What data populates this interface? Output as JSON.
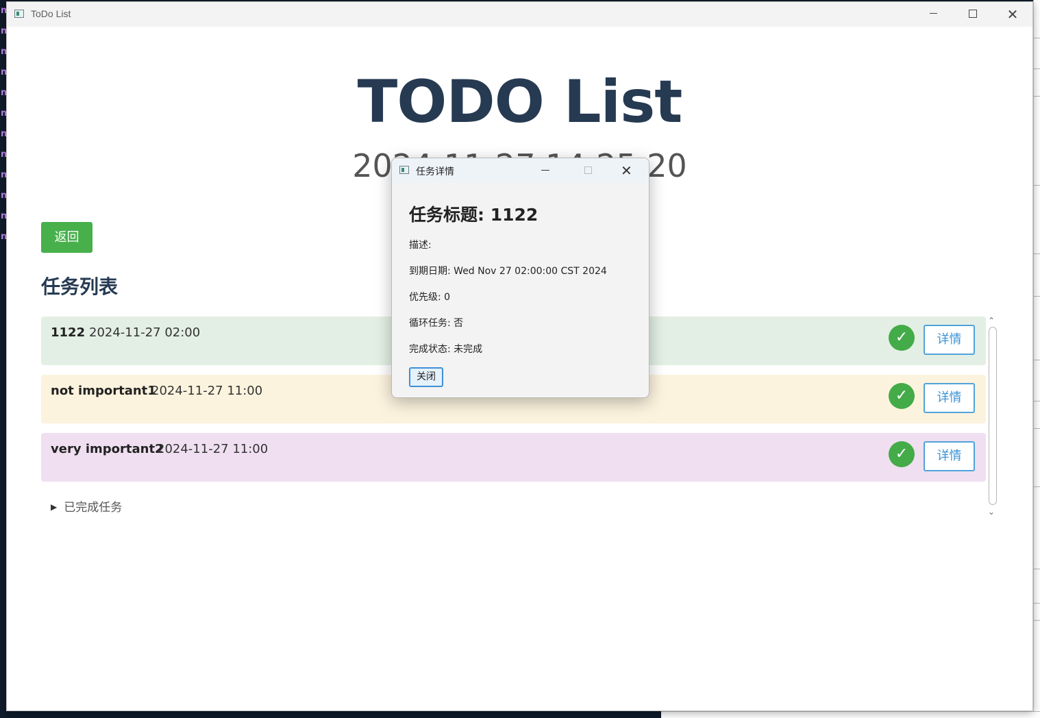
{
  "window": {
    "title": "ToDo List",
    "app_title": "TODO List",
    "clock": "2024-11-27 14:25:20"
  },
  "back_button": "返回",
  "section_title": "任务列表",
  "tasks": [
    {
      "name": "1122",
      "date": "2024-11-27 02:00",
      "bg": "#e3efe4",
      "done_icon": "check-icon",
      "done_glyph": "✓",
      "detail_label": "详情"
    },
    {
      "name": "not important1",
      "date": "2024-11-27 11:00",
      "bg": "#fcf3de",
      "done_icon": "check-icon",
      "done_glyph": "✓",
      "detail_label": "详情"
    },
    {
      "name": "very important2",
      "date": "2024-11-27 11:00",
      "bg": "#efdff0",
      "done_icon": "check-icon",
      "done_glyph": "✓",
      "detail_label": "详情"
    }
  ],
  "completed_section": {
    "toggle_glyph": "▶",
    "label": "已完成任务"
  },
  "dialog": {
    "title": "任务详情",
    "heading": "任务标题: 1122",
    "fields": [
      "描述:",
      "到期日期: Wed Nov 27 02:00:00 CST 2024",
      "优先级: 0",
      "循环任务: 否",
      "完成状态: 未完成"
    ],
    "close_label": "关闭"
  },
  "colors": {
    "accent_green": "#47b04b",
    "detail_blue": "#4fa3dc",
    "heading_navy": "#263a52"
  }
}
